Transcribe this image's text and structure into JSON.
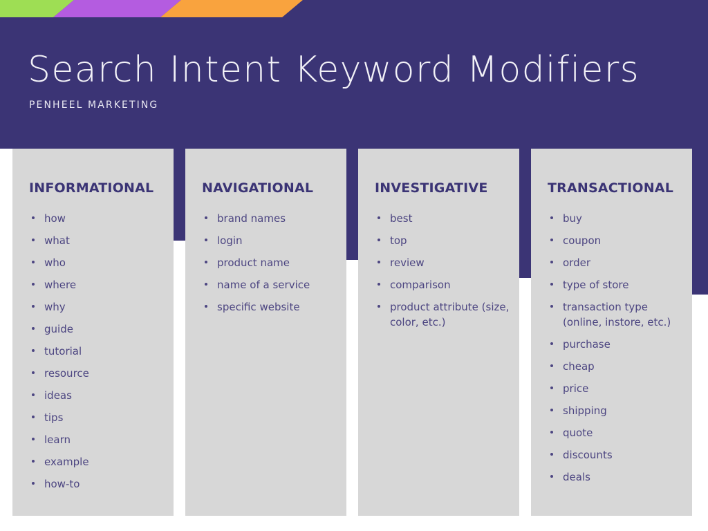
{
  "colors": {
    "background_purple": "#3b3475",
    "card_background": "#d7d7d7",
    "heading_text": "#3b3475",
    "body_text": "#4c4581",
    "title_text": "#f2f1f7",
    "stripe_green": "#9ede54",
    "stripe_purple": "#b45ce0",
    "stripe_orange": "#f9a33e",
    "page_background": "#ffffff"
  },
  "header": {
    "title": "Search Intent Keyword Modifiers",
    "subtitle": "PENHEEL MARKETING"
  },
  "stripes": [
    {
      "name": "stripe-green",
      "color": "#9ede54"
    },
    {
      "name": "stripe-purple",
      "color": "#b45ce0"
    },
    {
      "name": "stripe-orange",
      "color": "#f9a33e"
    }
  ],
  "columns": [
    {
      "title": "INFORMATIONAL",
      "items": [
        "how",
        "what",
        "who",
        "where",
        "why",
        "guide",
        "tutorial",
        "resource",
        "ideas",
        "tips",
        "learn",
        "example",
        "how-to"
      ]
    },
    {
      "title": "NAVIGATIONAL",
      "items": [
        "brand names",
        "login",
        "product name",
        "name of a service",
        "specific website"
      ]
    },
    {
      "title": "INVESTIGATIVE",
      "items": [
        "best",
        "top",
        "review",
        "comparison",
        "product attribute (size, color, etc.)"
      ]
    },
    {
      "title": "TRANSACTIONAL",
      "items": [
        "buy",
        "coupon",
        "order",
        "type of store",
        "transaction type (online, instore, etc.)",
        "purchase",
        "cheap",
        "price",
        "shipping",
        "quote",
        "discounts",
        "deals"
      ]
    }
  ]
}
